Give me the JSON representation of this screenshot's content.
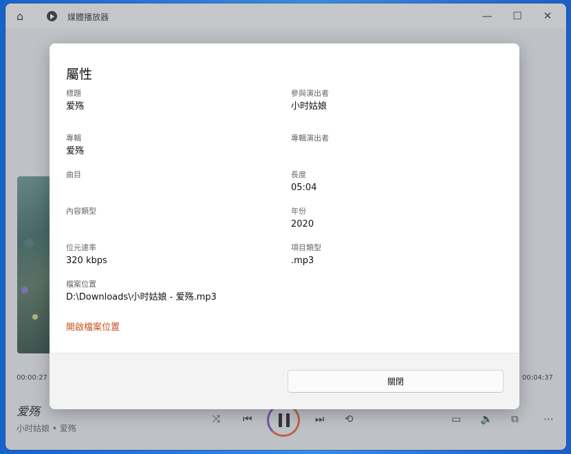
{
  "window": {
    "title": "媒體播放器",
    "home_icon": "home-icon",
    "minimize": "—",
    "maximize": "☐",
    "close": "✕"
  },
  "player": {
    "elapsed": "00:00:27",
    "duration": "00:04:37",
    "song_title": "爱殇",
    "song_artist": "小时姑娘 • 爱殇"
  },
  "dialog": {
    "title": "屬性",
    "fields": [
      {
        "label": "標題",
        "value": "爱殇"
      },
      {
        "label": "參與演出者",
        "value": "小时姑娘"
      },
      {
        "label": "專輯",
        "value": "爱殇"
      },
      {
        "label": "專輯演出者",
        "value": ""
      },
      {
        "label": "曲目",
        "value": ""
      },
      {
        "label": "長度",
        "value": "05:04"
      },
      {
        "label": "內容類型",
        "value": ""
      },
      {
        "label": "年份",
        "value": "2020"
      },
      {
        "label": "位元速率",
        "value": "320 kbps"
      },
      {
        "label": "項目類型",
        "value": ".mp3"
      },
      {
        "label": "檔案位置",
        "value": "D:\\Downloads\\小时姑娘 - 爱殇.mp3"
      }
    ],
    "open_location": "開啟檔案位置",
    "close_button": "關閉"
  },
  "colors": {
    "link": "#c8501e",
    "accent_ring": "#e2572c"
  }
}
